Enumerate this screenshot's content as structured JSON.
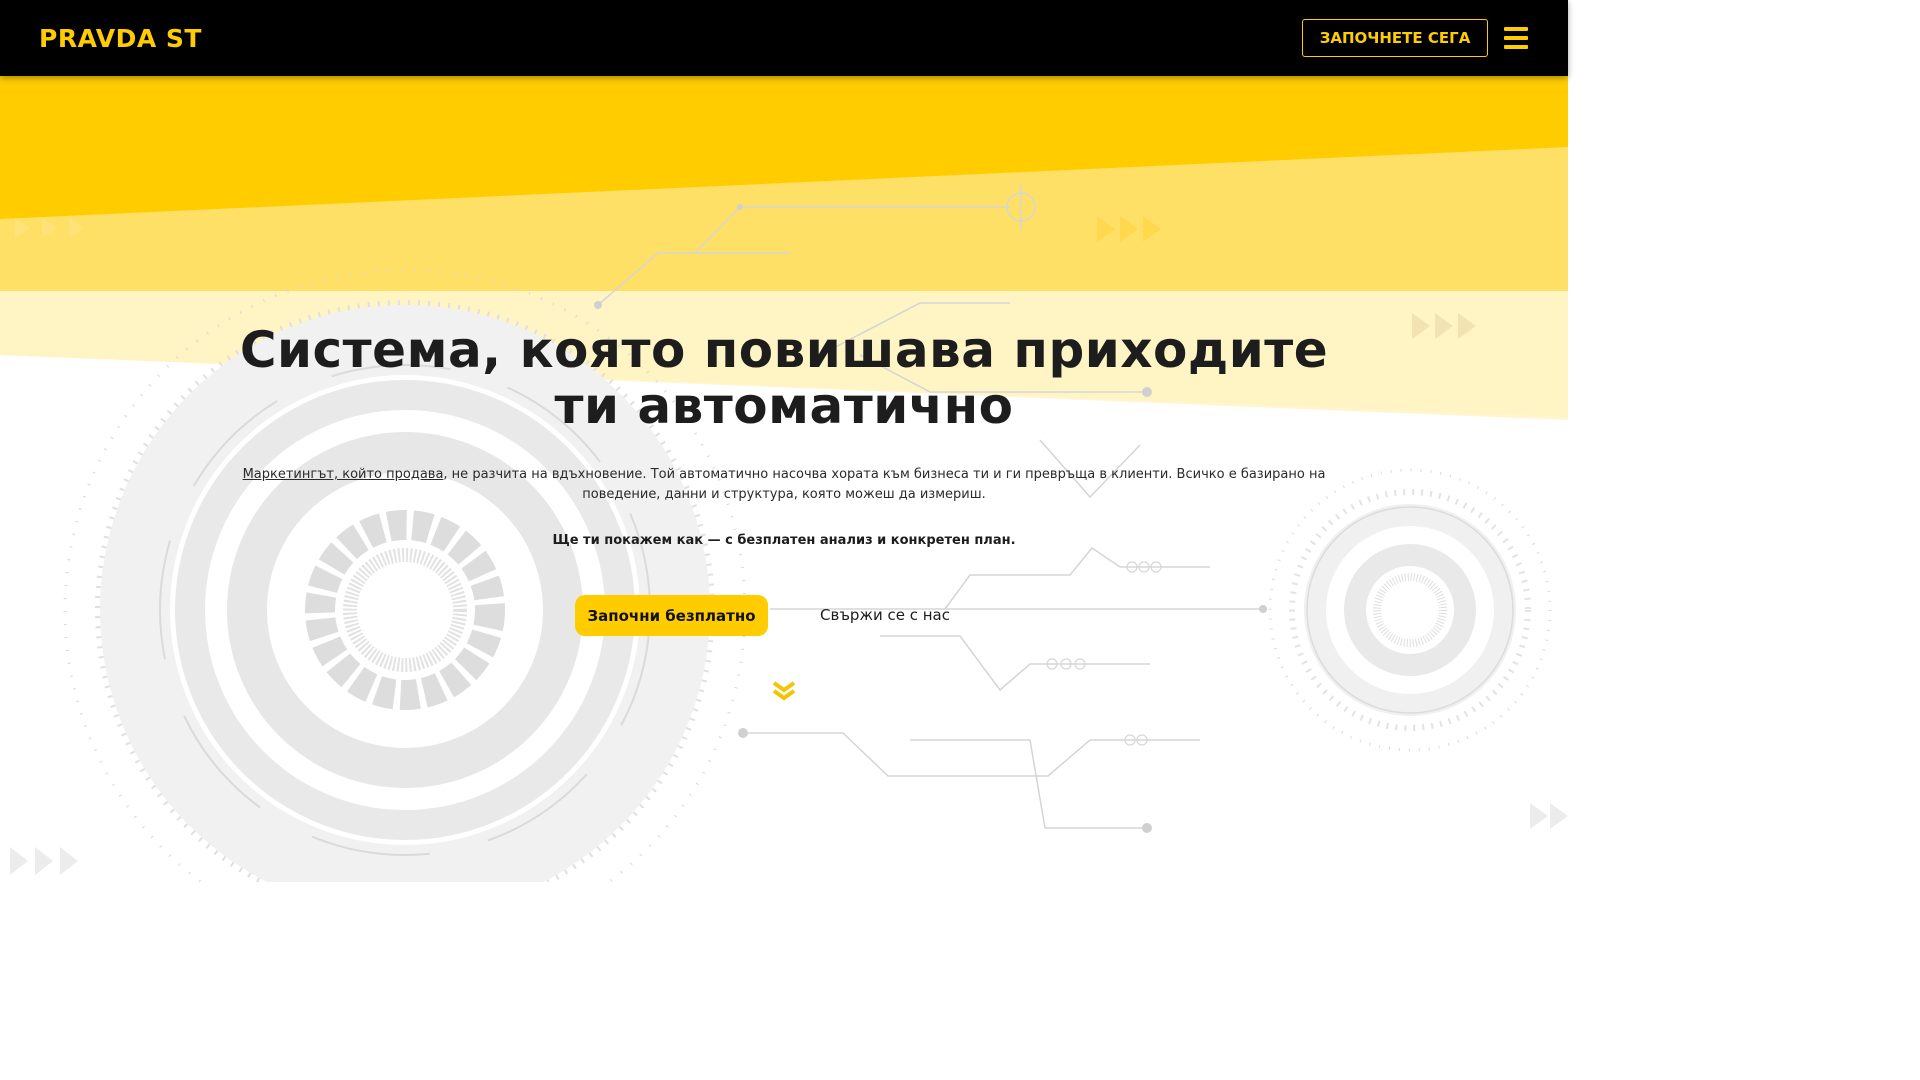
{
  "header": {
    "logo_text": "PRAVDA ST",
    "cta_label": "ЗАПОЧНЕТЕ СЕГА",
    "menu_icon": "hamburger-menu-icon"
  },
  "hero": {
    "headline_line1": "Система, която повишава приходите",
    "headline_line2": "ти автоматично",
    "intro_link_text": "Маркетингът, който продава",
    "intro_text": ", не разчита на вдъхновение. Той автоматично насочва хората към бизнеса ти и ги превръща в клиенти. Всичко е базирано на поведение, данни и структура, която можеш да измериш.",
    "sub_text": "Ще ти покажем как — с безплатен анализ и конкретен план.",
    "primary_button": "Започни безплатно",
    "secondary_button": "Свържи се с нас",
    "scroll_icon": "chevron-double-down-icon"
  },
  "colors": {
    "accent": "#ffcc00",
    "navbar_bg": "#000000",
    "text_dark": "#1d1d1d"
  }
}
